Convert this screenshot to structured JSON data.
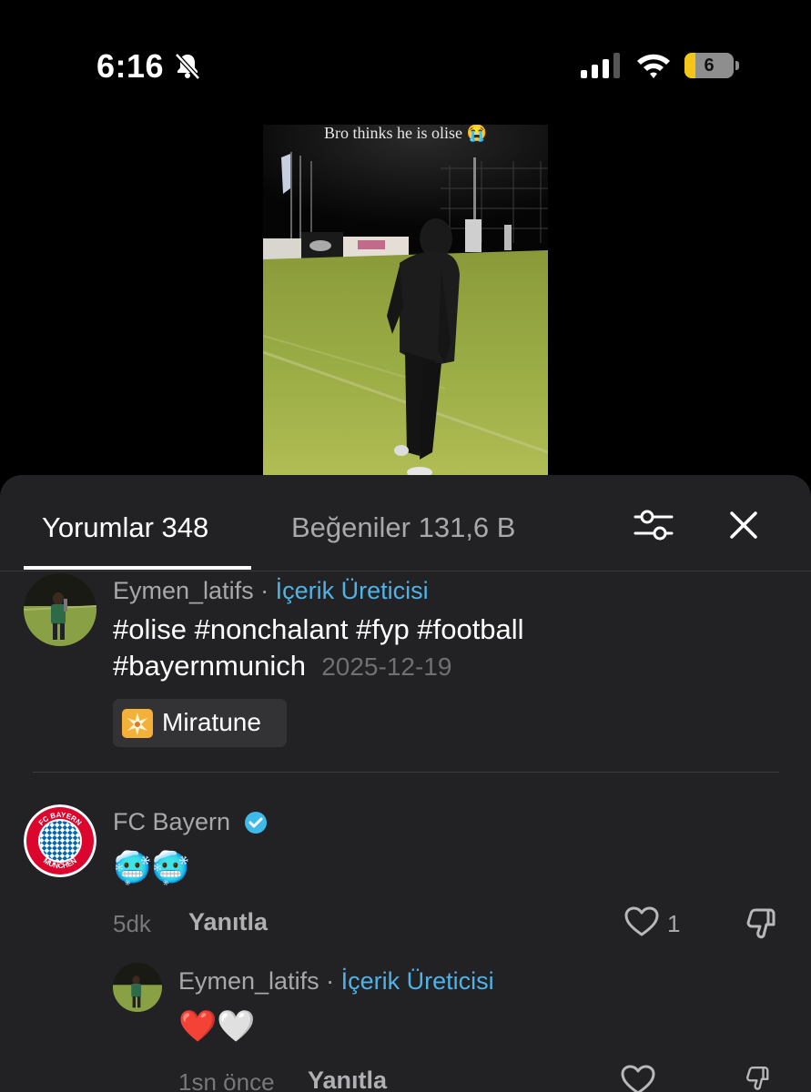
{
  "status_bar": {
    "time": "6:16",
    "battery_level": "6",
    "icons": [
      "bell-slash-icon",
      "signal-icon",
      "wifi-icon",
      "battery-icon"
    ]
  },
  "video": {
    "caption": "Bro thinks he is olise 😭"
  },
  "sheet": {
    "tabs": [
      {
        "label": "Yorumlar 348",
        "active": true
      },
      {
        "label": "Beğeniler 131,6 B",
        "active": false
      }
    ],
    "filter_icon": "sliders-icon",
    "close_icon": "close-icon"
  },
  "caption_comment": {
    "username": "Eymen_latifs",
    "separator": "·",
    "badge": "İçerik Üreticisi",
    "text_line1": "#olise #nonchalant #fyp #football",
    "text_line2": "#bayernmunich",
    "date": "2025-12-19",
    "music": "Miratune"
  },
  "comments": [
    {
      "username": "FC Bayern",
      "verified": true,
      "text": "🥶🥶",
      "time": "5dk",
      "reply_label": "Yanıtla",
      "likes": "1"
    }
  ],
  "replies": [
    {
      "username": "Eymen_latifs",
      "separator": "·",
      "badge": "İçerik Üreticisi",
      "text": "❤️🤍",
      "time": "1sn önce",
      "reply_label": "Yanıtla"
    }
  ],
  "colors": {
    "sheet_bg": "#222224",
    "creator_badge": "#4fb3e8",
    "verified": "#3fb8ea",
    "battery_fill": "#f5c518"
  }
}
